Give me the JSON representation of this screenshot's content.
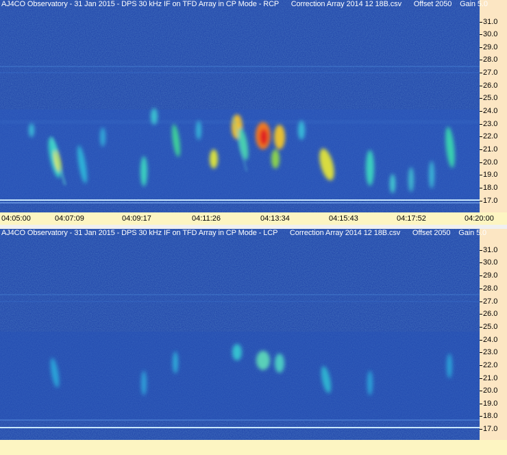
{
  "top_panel": {
    "title": "AJ4CO Observatory - 31 Jan 2015 - DPS 30 kHz IF on TFD Array in CP Mode - RCP      Correction Array 2014 12 18B.csv      Offset 2050    Gain 5.0",
    "y_ticks": [
      "31.0",
      "30.0",
      "29.0",
      "28.0",
      "27.0",
      "26.0",
      "25.0",
      "24.0",
      "23.0",
      "22.0",
      "21.0",
      "20.0",
      "19.0",
      "18.0",
      "17.0"
    ],
    "x_ticks": [
      "04:05:00",
      "04:07:09",
      "04:09:17",
      "04:11:26",
      "04:13:34",
      "04:15:43",
      "04:17:52",
      "04:20:00"
    ]
  },
  "bottom_panel": {
    "title": "AJ4CO Observatory - 31 Jan 2015 - DPS 30 kHz IF on TFD Array in CP Mode - LCP      Correction Array 2014 12 18B.csv      Offset 2050    Gain 5.0",
    "y_ticks": [
      "31.0",
      "30.0",
      "29.0",
      "28.0",
      "27.0",
      "26.0",
      "25.0",
      "24.0",
      "23.0",
      "22.0",
      "21.0",
      "20.0",
      "19.0",
      "18.0",
      "17.0"
    ]
  },
  "colors": {
    "background_blue": "#1c3fa8",
    "hot_red": "#e02020",
    "axis_bg": "#fce6c3",
    "time_axis_bg": "#fdf5c2"
  }
}
